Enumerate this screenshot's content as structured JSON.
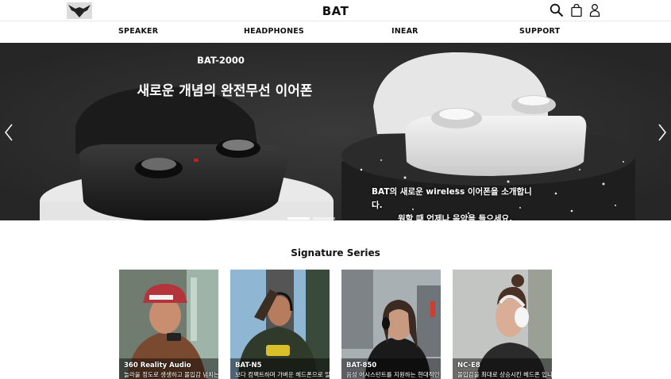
{
  "header": {
    "brand": "BAT",
    "icons": [
      "bat-logo-icon",
      "search-icon",
      "shopping-bag-icon",
      "user-icon"
    ]
  },
  "nav": {
    "items": [
      {
        "label": "SPEAKER"
      },
      {
        "label": "HEADPHONES"
      },
      {
        "label": "INEAR"
      },
      {
        "label": "SUPPORT"
      }
    ]
  },
  "hero": {
    "subtitle": "BAT-2000",
    "title": "새로운 개념의 완전무선 이어폰",
    "desc_line1": "BAT의 새로운 wireless 이어폰을 소개합니다.",
    "desc_line2": "원할 때 언제나 음악을 들으세요.",
    "slides": 2,
    "active_slide": 1
  },
  "signature": {
    "title": "Signature Series",
    "cards": [
      {
        "name": "360 Reality Audio",
        "desc": "놀라울 정도로 생생하고 몰입감 넘치는"
      },
      {
        "name": "BAT-N5",
        "desc": "보다 컴팩트하며 가벼운 헤드폰으로 일"
      },
      {
        "name": "BAT-850",
        "desc": "음성 어시스턴트를 지원하는 현대적인"
      },
      {
        "name": "NC-E8",
        "desc": "몰입감을 최대로 상승시킨 헤드폰 입니"
      }
    ]
  },
  "colors": {
    "hero_bg": "#2c2c2c",
    "text": "#111111",
    "white": "#ffffff"
  }
}
